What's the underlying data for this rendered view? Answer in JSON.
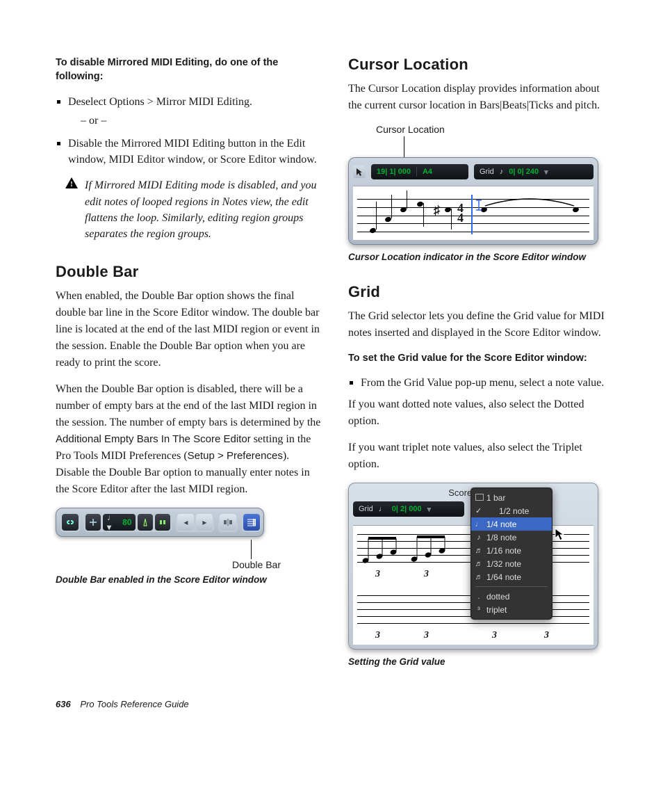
{
  "left": {
    "instr_heading": "To disable Mirrored MIDI Editing, do one of the following:",
    "bullet1": "Deselect Options > Mirror MIDI Editing.",
    "or": "– or –",
    "bullet2": "Disable the Mirrored MIDI Editing button in the Edit window, MIDI Editor window, or Score Editor window.",
    "note": "If Mirrored MIDI Editing mode is disabled, and you edit notes of looped regions in Notes view, the edit flattens the loop. Similarly, editing region groups separates the region groups.",
    "h_doublebar": "Double Bar",
    "db_p1": "When enabled, the Double Bar option shows the final double bar line in the Score Editor window. The double bar line is located at the end of the last MIDI region or event in the session. Enable the Double Bar option when you are ready to print the score.",
    "db_p2a": "When the Double Bar option is disabled, there will be a number of empty bars at the end of the last MIDI region in the session. The number of empty bars is determined by the ",
    "db_setting": "Additional Empty Bars In The Score Editor",
    "db_p2b": " setting in the Pro Tools MIDI Preferences (",
    "db_menu": "Setup > Preferences",
    "db_p2c": "). Disable the Double Bar option to manually enter notes in the Score Editor after the last MIDI region.",
    "db_toolbar": {
      "tempo": "80"
    },
    "db_callout": "Double Bar",
    "db_caption": "Double Bar enabled in the Score Editor window"
  },
  "right": {
    "h_cursor": "Cursor Location",
    "cursor_p": "The Cursor Location display provides information about the current cursor location in Bars|Beats|Ticks and pitch.",
    "cl_callout": "Cursor Location",
    "cl_readout": {
      "loc": "19| 1| 000",
      "pitch": "A4",
      "grid_label": "Grid",
      "grid_val": "0| 0| 240"
    },
    "cl_caption": "Cursor Location indicator in the Score Editor window",
    "h_grid": "Grid",
    "grid_p": "The Grid selector lets you define the Grid value for MIDI notes inserted and displayed in the Score Editor window.",
    "grid_instr": "To set the Grid value for the Score Editor window:",
    "grid_bullet": "From the Grid Value pop-up menu, select a note value.",
    "grid_p2": "If you want dotted note values, also select the Dotted option.",
    "grid_p3": "If you want triplet note values, also select the Triplet option.",
    "se_title": "Score Editor",
    "grid_readout": {
      "label": "Grid",
      "val": "0| 2| 000"
    },
    "menu_items": {
      "bar": "1 bar",
      "n2": "1/2 note",
      "n4": "1/4 note",
      "n8": "1/8 note",
      "n16": "1/16 note",
      "n32": "1/32 note",
      "n64": "1/64 note",
      "dotted": "dotted",
      "triplet": "triplet"
    },
    "fig_triplet": "3",
    "grid_caption": "Setting the Grid value"
  },
  "footer": {
    "page": "636",
    "book": "Pro Tools Reference Guide"
  }
}
